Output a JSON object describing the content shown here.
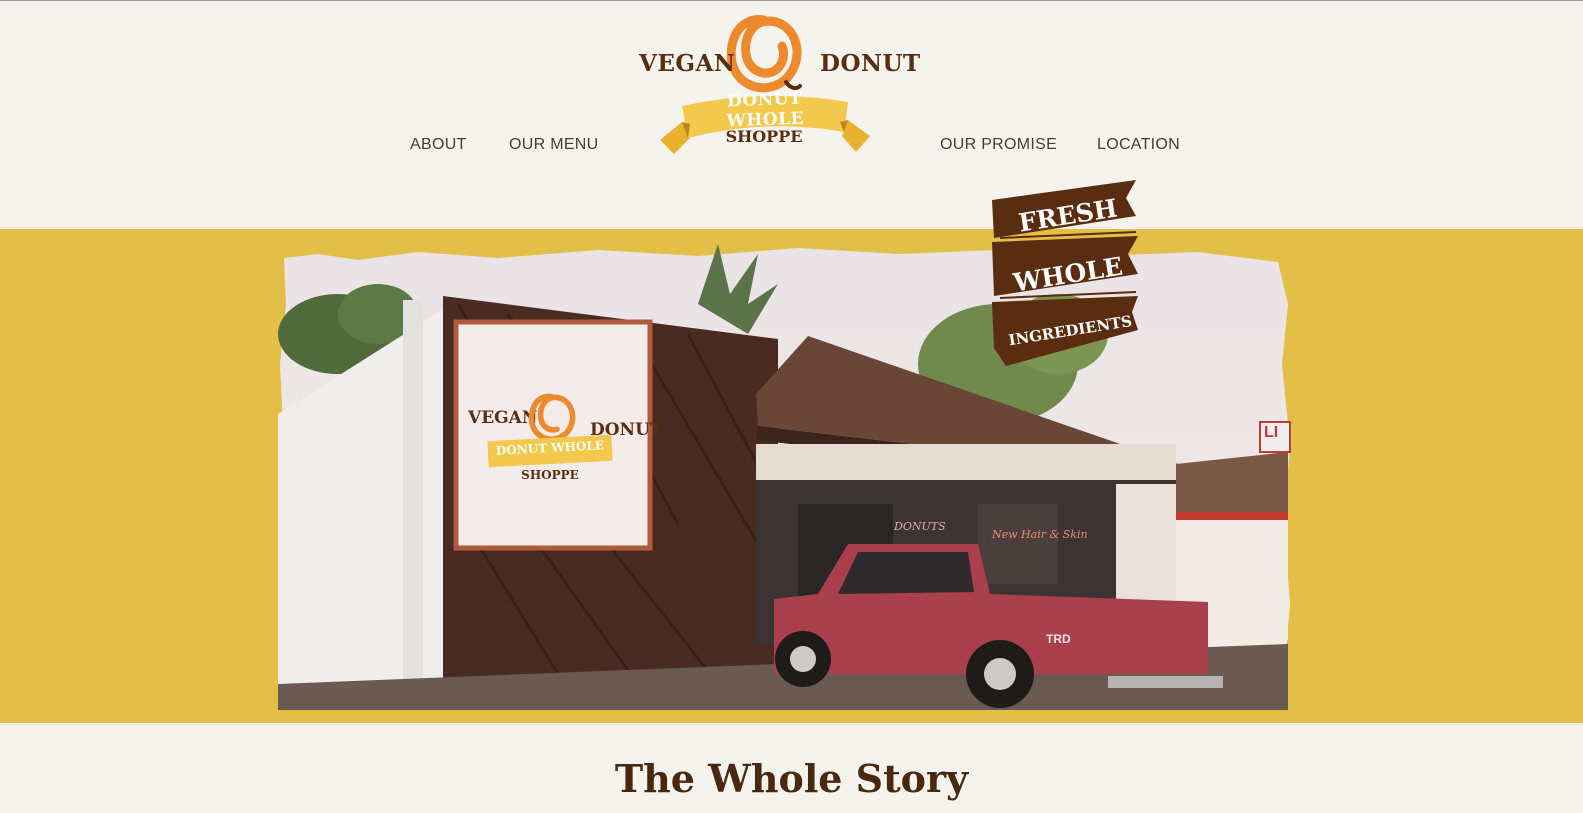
{
  "logo": {
    "word_left": "VEGAN",
    "word_right": "DONUT",
    "ribbon": "DONUT WHOLE",
    "subtitle": "SHOPPE",
    "colors": {
      "brown": "#5a2c10",
      "orange": "#ee8a2e",
      "gold": "#f2c94c"
    }
  },
  "nav": {
    "about": "ABOUT",
    "menu": "OUR MENU",
    "promise": "OUR PROMISE",
    "location": "LOCATION"
  },
  "hero": {
    "background": "#e4bf47",
    "sign": {
      "word_left": "VEGAN",
      "word_right": "DONUT",
      "ribbon": "DONUT WHOLE",
      "subtitle": "SHOPPE"
    },
    "window_text": "DONUTS",
    "window_text_right": "New Hair & Skin",
    "truck_badge": "TRD",
    "store_sign": "LI"
  },
  "badge": {
    "line1": "FRESH",
    "line2": "WHOLE",
    "line3": "INGREDIENTS"
  },
  "section": {
    "title": "The Whole Story"
  }
}
